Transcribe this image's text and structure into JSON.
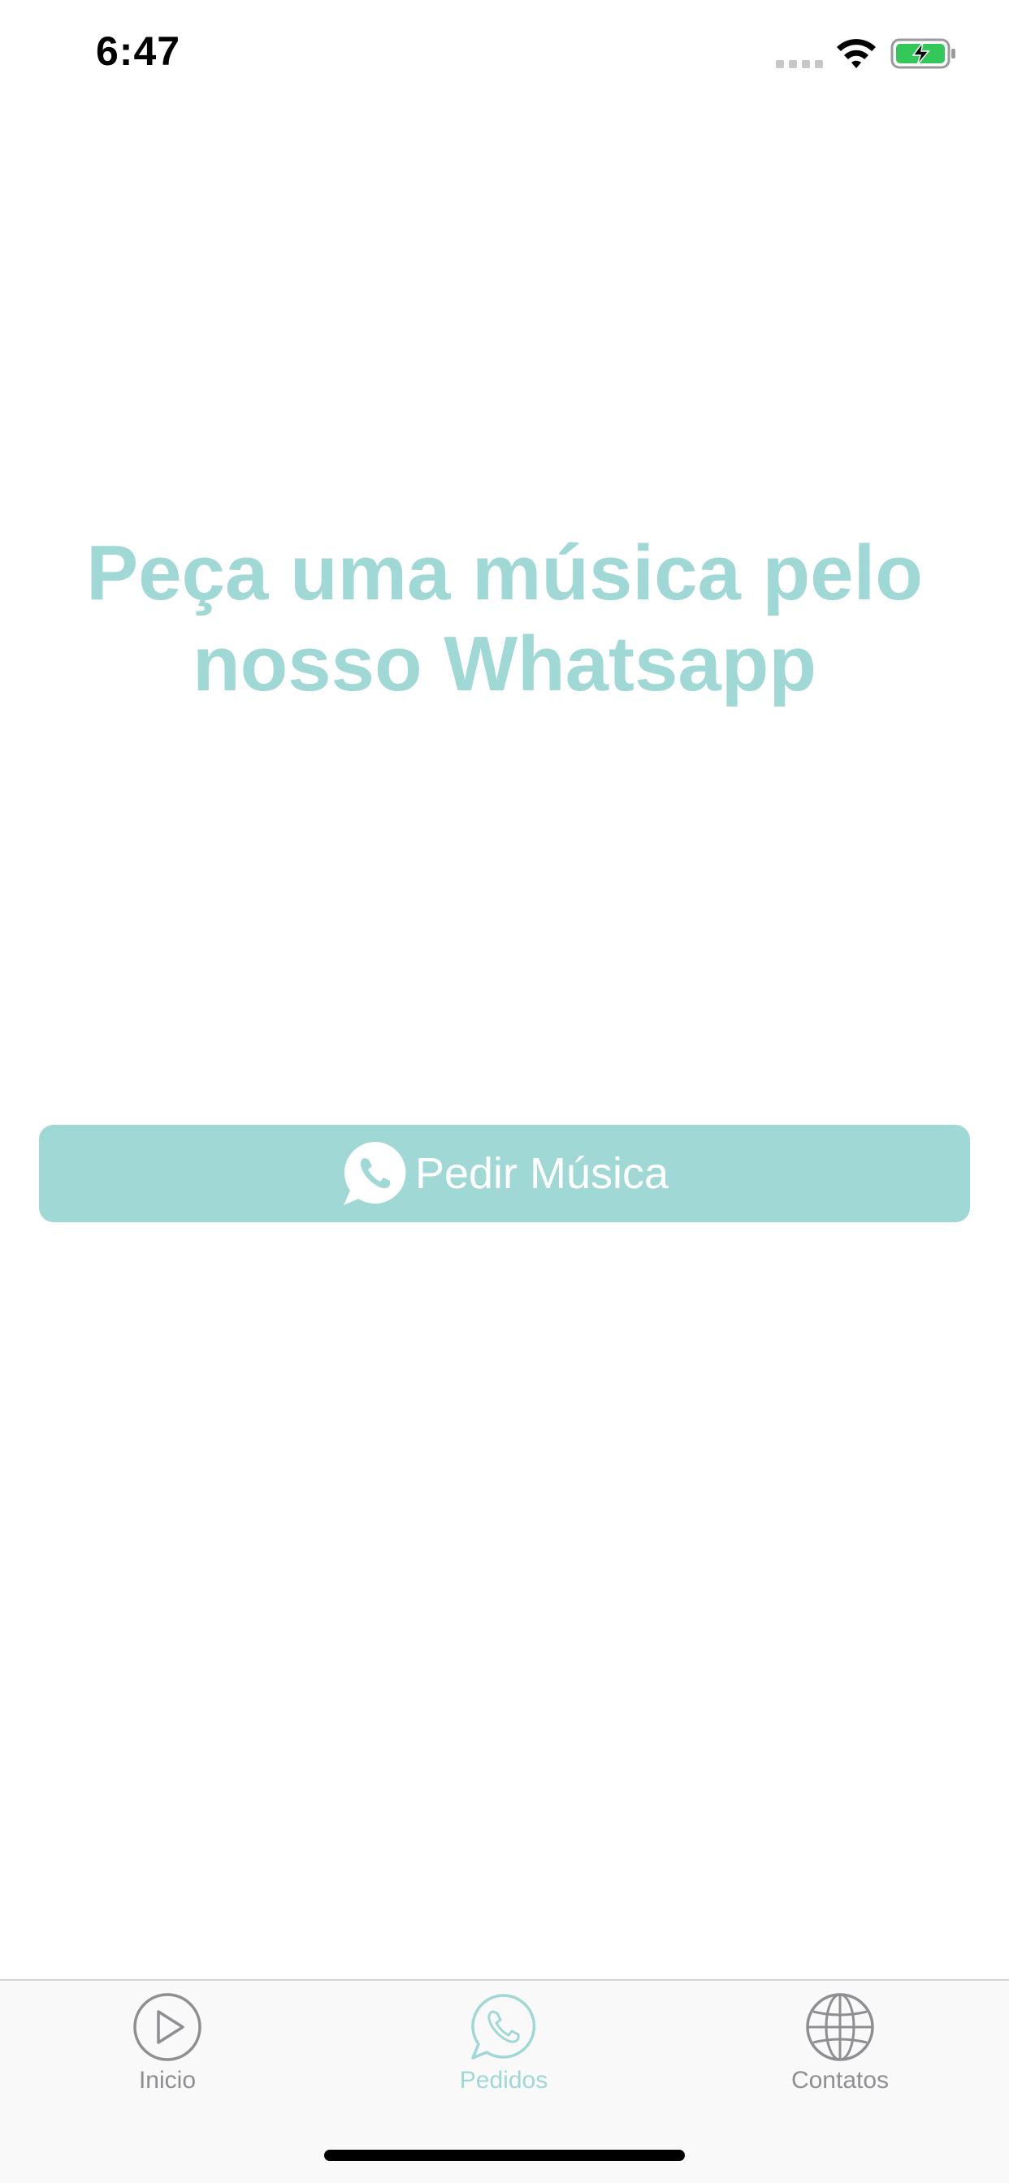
{
  "status_bar": {
    "time": "6:47"
  },
  "main": {
    "headline_line1": "Peça uma música pelo",
    "headline_line2": "nosso Whatsapp",
    "order_button_label": "Pedir Música"
  },
  "tab_bar": {
    "tabs": [
      {
        "label": "Inicio",
        "icon": "play-circle-icon",
        "active": false
      },
      {
        "label": "Pedidos",
        "icon": "whatsapp-icon",
        "active": true
      },
      {
        "label": "Contatos",
        "icon": "globe-icon",
        "active": false
      }
    ]
  },
  "colors": {
    "accent": "#9fd8d4",
    "inactive": "#8e8e93",
    "battery_fill": "#34c759"
  }
}
